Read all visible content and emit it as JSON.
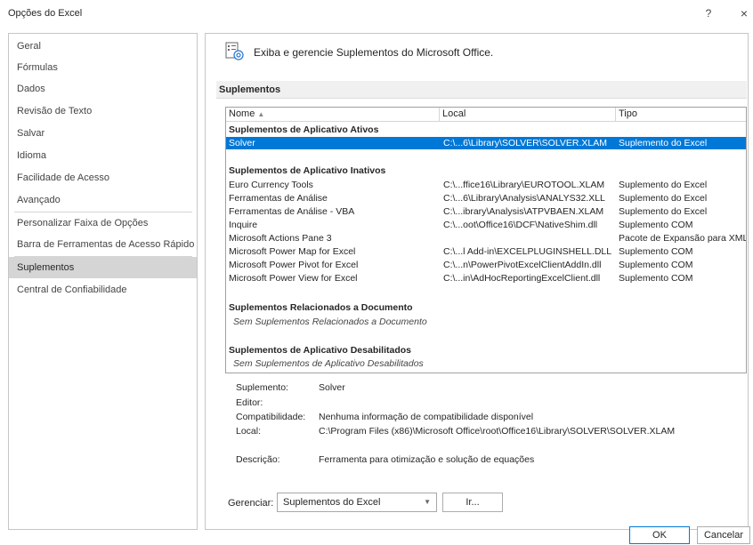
{
  "window": {
    "title": "Opções do Excel",
    "help": "?",
    "close": "×"
  },
  "sidebar": {
    "items": [
      {
        "label": "Geral"
      },
      {
        "label": "Fórmulas"
      },
      {
        "label": "Dados"
      },
      {
        "label": "Revisão de Texto"
      },
      {
        "label": "Salvar"
      },
      {
        "label": "Idioma"
      },
      {
        "label": "Facilidade de Acesso"
      },
      {
        "label": "Avançado"
      },
      {
        "label": "Personalizar Faixa de Opções"
      },
      {
        "label": "Barra de Ferramentas de Acesso Rápido"
      },
      {
        "label": "Suplementos"
      },
      {
        "label": "Central de Confiabilidade"
      }
    ],
    "active": "Suplementos"
  },
  "header": {
    "icon": "addins-gear-icon",
    "text": "Exiba e gerencie Suplementos do Microsoft Office."
  },
  "section": {
    "title": "Suplementos"
  },
  "table": {
    "columns": {
      "nome": "Nome",
      "sort_indicator": "▲",
      "local": "Local",
      "tipo": "Tipo"
    },
    "groups": {
      "active_title": "Suplementos de Aplicativo Ativos",
      "inactive_title": "Suplementos de Aplicativo Inativos",
      "document_title": "Suplementos Relacionados a Documento",
      "document_empty": "Sem Suplementos Relacionados a Documento",
      "disabled_title": "Suplementos de Aplicativo Desabilitados",
      "disabled_empty": "Sem Suplementos de Aplicativo Desabilitados"
    },
    "active_rows": [
      {
        "nome": "Solver",
        "local": "C:\\...6\\Library\\SOLVER\\SOLVER.XLAM",
        "tipo": "Suplemento do Excel"
      }
    ],
    "inactive_rows": [
      {
        "nome": "Euro Currency Tools",
        "local": "C:\\...ffice16\\Library\\EUROTOOL.XLAM",
        "tipo": "Suplemento do Excel"
      },
      {
        "nome": "Ferramentas de Análise",
        "local": "C:\\...6\\Library\\Analysis\\ANALYS32.XLL",
        "tipo": "Suplemento do Excel"
      },
      {
        "nome": "Ferramentas de Análise - VBA",
        "local": "C:\\...ibrary\\Analysis\\ATPVBAEN.XLAM",
        "tipo": "Suplemento do Excel"
      },
      {
        "nome": "Inquire",
        "local": "C:\\...oot\\Office16\\DCF\\NativeShim.dll",
        "tipo": "Suplemento COM"
      },
      {
        "nome": "Microsoft Actions Pane 3",
        "local": "",
        "tipo": "Pacote de Expansão para XML"
      },
      {
        "nome": "Microsoft Power Map for Excel",
        "local": "C:\\...l Add-in\\EXCELPLUGINSHELL.DLL",
        "tipo": "Suplemento COM"
      },
      {
        "nome": "Microsoft Power Pivot for Excel",
        "local": "C:\\...n\\PowerPivotExcelClientAddIn.dll",
        "tipo": "Suplemento COM"
      },
      {
        "nome": "Microsoft Power View for Excel",
        "local": "C:\\...in\\AdHocReportingExcelClient.dll",
        "tipo": "Suplemento COM"
      }
    ]
  },
  "details": {
    "suplemento_label": "Suplemento:",
    "suplemento_value": "Solver",
    "editor_label": "Editor:",
    "editor_value": "",
    "compat_label": "Compatibilidade:",
    "compat_value": "Nenhuma informação de compatibilidade disponível",
    "local_label": "Local:",
    "local_value": "C:\\Program Files (x86)\\Microsoft Office\\root\\Office16\\Library\\SOLVER\\SOLVER.XLAM",
    "desc_label": "Descrição:",
    "desc_value": "Ferramenta para otimização e solução de equações"
  },
  "manage": {
    "label": "Gerenciar:",
    "selected": "Suplementos do Excel",
    "go_button": "Ir..."
  },
  "footer": {
    "ok": "OK",
    "cancel": "Cancelar"
  }
}
